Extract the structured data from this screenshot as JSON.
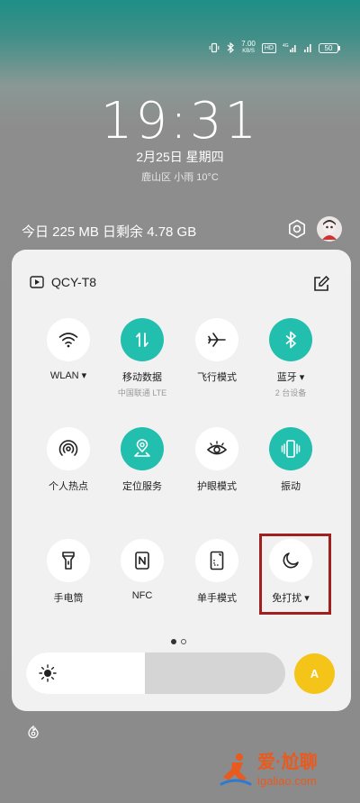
{
  "status_bar": {
    "net_speed": "7.00",
    "net_speed_unit": "KB/S",
    "hd_label": "HD",
    "signal_label": "4G",
    "battery": "50"
  },
  "lockscreen": {
    "time": "19:31",
    "date": "2月25日  星期四",
    "weather": "鹿山区 小雨 10°C"
  },
  "data_usage": "今日 225 MB 日剩余 4.78 GB",
  "panel": {
    "media_device": "QCY-T8",
    "tiles": [
      {
        "label": "WLAN",
        "sub": "",
        "on": false,
        "dropdown": true,
        "icon": "wifi-icon"
      },
      {
        "label": "移动数据",
        "sub": "中国联通 LTE",
        "on": true,
        "dropdown": false,
        "icon": "mobile-data-icon"
      },
      {
        "label": "飞行模式",
        "sub": "",
        "on": false,
        "dropdown": false,
        "icon": "airplane-icon"
      },
      {
        "label": "蓝牙",
        "sub": "2 台设备",
        "on": true,
        "dropdown": true,
        "icon": "bluetooth-icon"
      },
      {
        "label": "个人热点",
        "sub": "",
        "on": false,
        "dropdown": false,
        "icon": "hotspot-icon"
      },
      {
        "label": "定位服务",
        "sub": "",
        "on": true,
        "dropdown": false,
        "icon": "location-icon"
      },
      {
        "label": "护眼模式",
        "sub": "",
        "on": false,
        "dropdown": false,
        "icon": "eye-icon"
      },
      {
        "label": "振动",
        "sub": "",
        "on": true,
        "dropdown": false,
        "icon": "vibrate-icon"
      },
      {
        "label": "手电筒",
        "sub": "",
        "on": false,
        "dropdown": false,
        "icon": "flashlight-icon"
      },
      {
        "label": "NFC",
        "sub": "",
        "on": false,
        "dropdown": false,
        "icon": "nfc-icon"
      },
      {
        "label": "单手模式",
        "sub": "",
        "on": false,
        "dropdown": false,
        "icon": "one-hand-icon"
      },
      {
        "label": "免打扰",
        "sub": "",
        "on": false,
        "dropdown": true,
        "icon": "moon-icon"
      }
    ],
    "brightness_level": 0.46,
    "auto_brightness_label": "A",
    "page_count": 2,
    "current_page": 1
  },
  "watermark": {
    "cn": "爱·尬聊",
    "en": "igaliao.com"
  },
  "colors": {
    "tile_on": "#22bfae",
    "highlight": "#a11f1f",
    "auto_button": "#f5c418"
  }
}
